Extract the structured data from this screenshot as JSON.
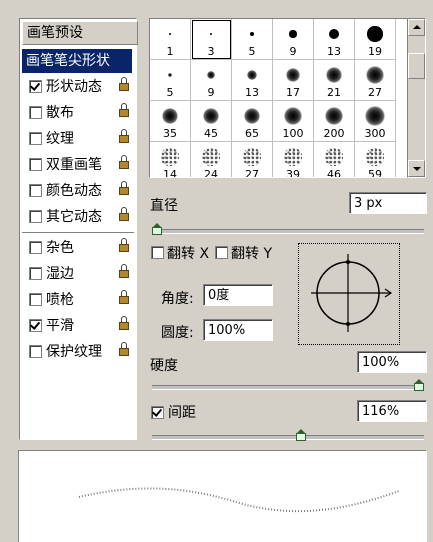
{
  "left_panel": {
    "presets_label": "画笔预设",
    "items": [
      {
        "label": "画笔笔尖形状",
        "selected": true
      },
      {
        "label": "形状动态",
        "checked": true,
        "locked": true
      },
      {
        "label": "散布",
        "checked": false,
        "locked": true
      },
      {
        "label": "纹理",
        "checked": false,
        "locked": true
      },
      {
        "label": "双重画笔",
        "checked": false,
        "locked": true
      },
      {
        "label": "颜色动态",
        "checked": false,
        "locked": true
      },
      {
        "label": "其它动态",
        "checked": false,
        "locked": true
      },
      {
        "label": "杂色",
        "checked": false,
        "locked": true
      },
      {
        "label": "湿边",
        "checked": false,
        "locked": true
      },
      {
        "label": "喷枪",
        "checked": false,
        "locked": true
      },
      {
        "label": "平滑",
        "checked": true,
        "locked": true
      },
      {
        "label": "保护纹理",
        "checked": false,
        "locked": true
      }
    ]
  },
  "brush_grid": {
    "selected_size": "3",
    "rows": [
      [
        "1",
        "3",
        "5",
        "9",
        "13",
        "19"
      ],
      [
        "5",
        "9",
        "13",
        "17",
        "21",
        "27"
      ],
      [
        "35",
        "45",
        "65",
        "100",
        "200",
        "300"
      ],
      [
        "14",
        "24",
        "27",
        "39",
        "46",
        "59"
      ]
    ]
  },
  "controls": {
    "diameter_label": "直径",
    "diameter_value": "3 px",
    "diameter_slider": 0.0,
    "flip_x_label": "翻转 X",
    "flip_y_label": "翻转 Y",
    "flip_x_checked": false,
    "flip_y_checked": false,
    "angle_label": "角度:",
    "angle_value": "0度",
    "roundness_label": "圆度:",
    "roundness_value": "100%",
    "hardness_label": "硬度",
    "hardness_value": "100%",
    "hardness_slider": 1.0,
    "spacing_label": "间距",
    "spacing_checked": true,
    "spacing_value": "116%",
    "spacing_slider": 0.55
  },
  "colors": {
    "panel": "#d4d0c8",
    "selection": "#0a246a",
    "slider_knob": "#dfd"
  }
}
